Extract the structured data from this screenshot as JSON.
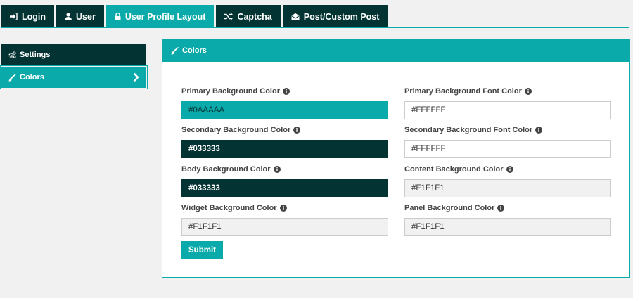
{
  "tabs": [
    {
      "label": "Login",
      "icon": "sign-in-icon"
    },
    {
      "label": "User",
      "icon": "user-icon"
    },
    {
      "label": "User Profile Layout",
      "icon": "lock-icon",
      "active": true
    },
    {
      "label": "Captcha",
      "icon": "random-icon"
    },
    {
      "label": "Post/Custom Post",
      "icon": "envelope-open-icon"
    }
  ],
  "sidebar": {
    "items": [
      {
        "label": "Settings",
        "icon": "gears-icon"
      },
      {
        "label": "Colors",
        "icon": "paint-brush-icon",
        "active": true
      }
    ]
  },
  "panel": {
    "title": "Colors",
    "submit_label": "Submit"
  },
  "fields": {
    "primary_bg": {
      "label": "Primary Background Color",
      "value": "#0AAAAA"
    },
    "secondary_bg": {
      "label": "Secondary Background Color",
      "value": "#033333"
    },
    "body_bg": {
      "label": "Body Background Color",
      "value": "#033333"
    },
    "widget_bg": {
      "label": "Widget Background Color",
      "value": "#F1F1F1"
    },
    "primary_font": {
      "label": "Primary Background Font Color",
      "value": "#FFFFFF"
    },
    "secondary_font": {
      "label": "Secondary Background Font Color",
      "value": "#FFFFFF"
    },
    "content_bg": {
      "label": "Content Background Color",
      "value": "#F1F1F1"
    },
    "panel_bg": {
      "label": "Panel Background Color",
      "value": "#F1F1F1"
    }
  },
  "colors": {
    "primary": "#0aaaaa",
    "secondary": "#033333",
    "page_background": "#f1f1f1"
  }
}
